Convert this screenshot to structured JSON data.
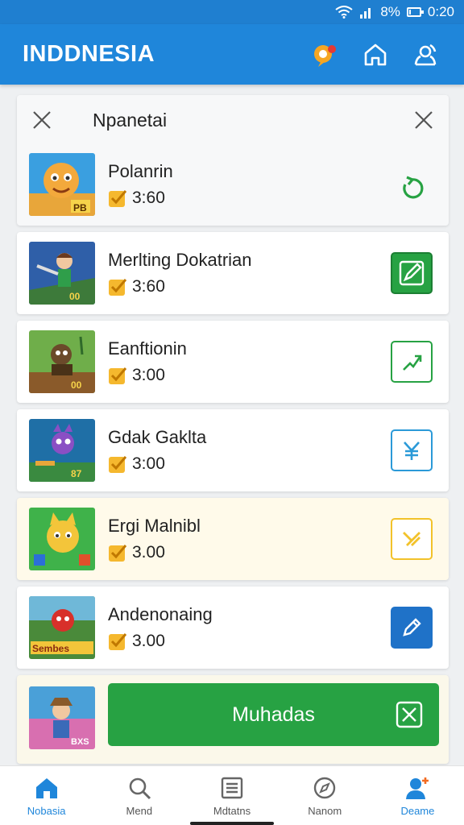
{
  "status": {
    "battery": "8%",
    "time": "0:20",
    "battery_level": 0.08
  },
  "app": {
    "title": "INDDNESIA",
    "actions": [
      "map-pin-icon",
      "home-icon",
      "user-icon"
    ]
  },
  "search": {
    "title": "Npanetai"
  },
  "items": [
    {
      "title": "Polanrin",
      "value": "3:60",
      "action_icon": "refresh-icon"
    },
    {
      "title": "Merlting Dokatrian",
      "value": "3:60",
      "action_icon": "edit-icon"
    },
    {
      "title": "Eanftionin",
      "value": "3:00",
      "action_icon": "trend-icon"
    },
    {
      "title": "Gdak Gaklta",
      "value": "3:00",
      "action_icon": "yen-icon"
    },
    {
      "title": "Ergi Malnibl",
      "value": "3.00",
      "action_icon": "star-icon"
    },
    {
      "title": "Andenonaing",
      "value": "3.00",
      "action_icon": "edit-icon"
    }
  ],
  "featured": {
    "button_label": "Muhadas",
    "thumb_text": "BXS"
  },
  "thumb_texts": [
    "PB",
    "00",
    "00",
    "87",
    "",
    "Sembes"
  ],
  "nav": [
    {
      "label": "Nobasia",
      "icon": "home-icon",
      "active": true
    },
    {
      "label": "Mend",
      "icon": "search-icon",
      "active": false
    },
    {
      "label": "Mdtatns",
      "icon": "list-icon",
      "active": false
    },
    {
      "label": "Nanom",
      "icon": "compass-icon",
      "active": false
    },
    {
      "label": "Deame",
      "icon": "profile-icon",
      "active": true
    }
  ],
  "colors": {
    "app_bar": "#1f86da",
    "green": "#27a243",
    "blue": "#1f86da",
    "yellow": "#f2c22a"
  }
}
